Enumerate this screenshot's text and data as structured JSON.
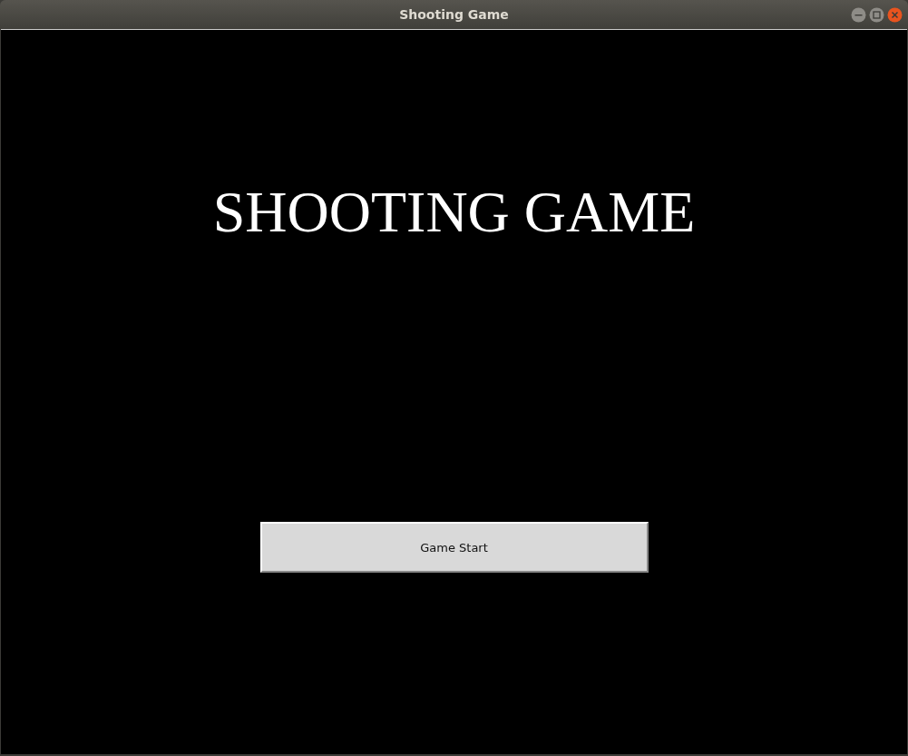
{
  "window": {
    "title": "Shooting Game"
  },
  "heading": "SHOOTING GAME",
  "start_button": "Game Start"
}
